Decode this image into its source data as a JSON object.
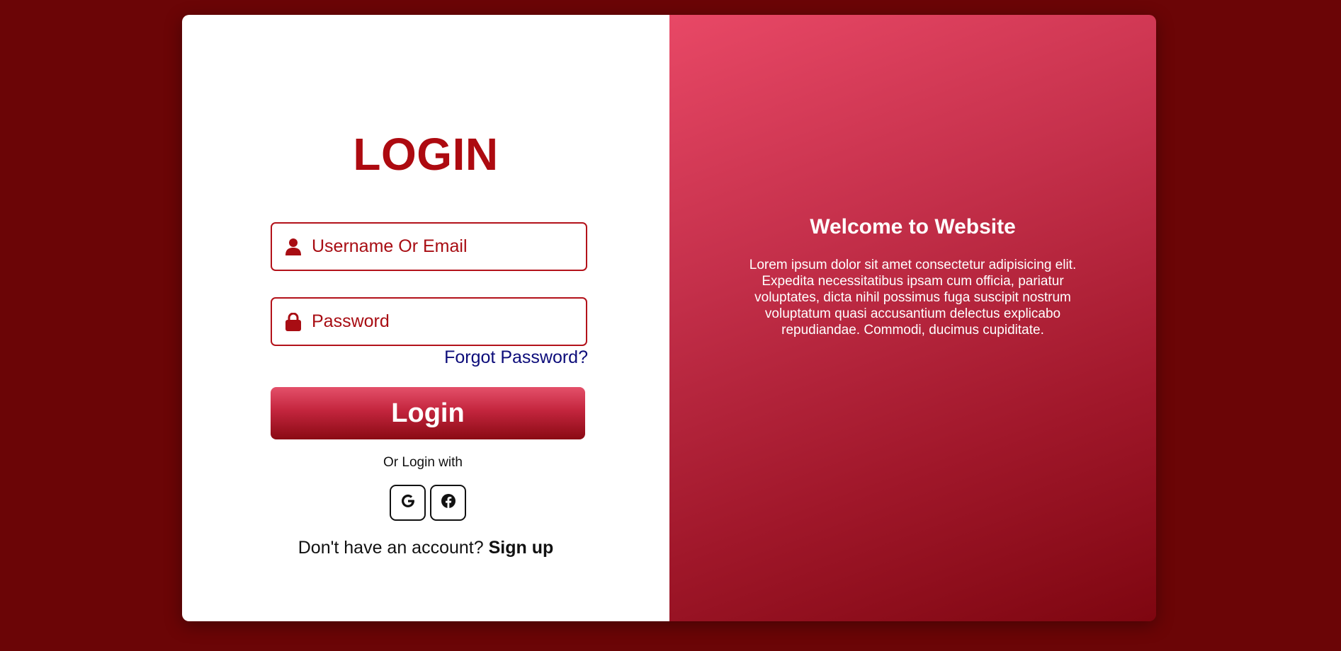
{
  "login": {
    "title": "LOGIN",
    "username_placeholder": "Username Or Email",
    "password_placeholder": "Password",
    "forgot_password": "Forgot Password?",
    "login_button": "Login",
    "or_login_with": "Or Login with",
    "social": [
      {
        "icon": "google-icon"
      },
      {
        "icon": "facebook-icon"
      }
    ],
    "no_account": "Don't have an account?",
    "signup": "Sign up"
  },
  "welcome": {
    "heading": "Welcome to Website",
    "body": "Lorem ipsum dolor sit amet consectetur adipisicing elit. Expedita necessitatibus ipsam cum officia, pariatur voluptates, dicta nihil possimus fuga suscipit nostrum voluptatum quasi accusantium delectus explicabo repudiandae. Commodi, ducimus cupiditate."
  },
  "colors": {
    "page_background": "#6b0506",
    "accent": "#ad0a10",
    "link": "#0c0c7a"
  }
}
